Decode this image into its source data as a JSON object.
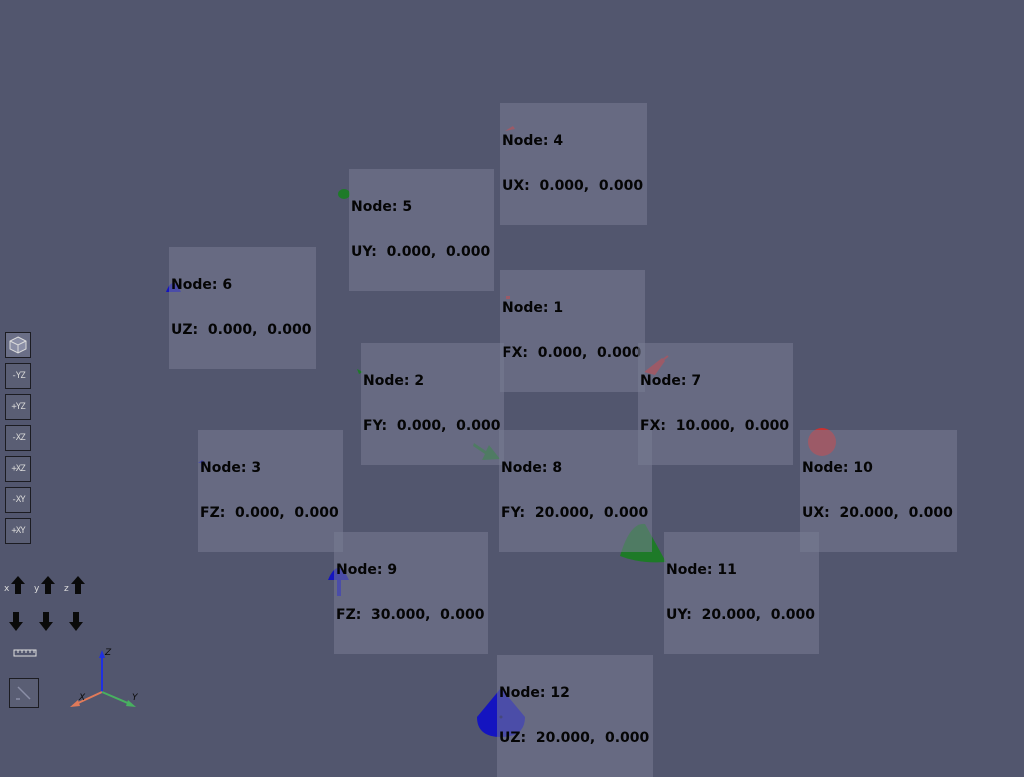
{
  "nodes": [
    {
      "title": "Node: 4",
      "value": "UX:  0.000,  0.000"
    },
    {
      "title": "Node: 5",
      "value": "UY:  0.000,  0.000"
    },
    {
      "title": "Node: 6",
      "value": "UZ:  0.000,  0.000"
    },
    {
      "title": "Node: 1",
      "value": "FX:  0.000,  0.000"
    },
    {
      "title": "Node: 2",
      "value": "FY:  0.000,  0.000"
    },
    {
      "title": "Node: 7",
      "value": "FX:  10.000,  0.000"
    },
    {
      "title": "Node: 3",
      "value": "FZ:  0.000,  0.000"
    },
    {
      "title": "Node: 8",
      "value": "FY:  20.000,  0.000"
    },
    {
      "title": "Node: 10",
      "value": "UX:  20.000,  0.000"
    },
    {
      "title": "Node: 9",
      "value": "FZ:  30.000,  0.000"
    },
    {
      "title": "Node: 11",
      "value": "UY:  20.000,  0.000"
    },
    {
      "title": "Node: 12",
      "value": "UZ:  20.000,  0.000"
    }
  ],
  "toolbar": {
    "views": [
      {
        "icon": "cube-icon",
        "label": ""
      },
      {
        "icon": "view-neg-yz-icon",
        "label": "-YZ"
      },
      {
        "icon": "view-pos-yz-icon",
        "label": "+YZ"
      },
      {
        "icon": "view-neg-xz-icon",
        "label": "-XZ"
      },
      {
        "icon": "view-pos-xz-icon",
        "label": "+XZ"
      },
      {
        "icon": "view-neg-xy-icon",
        "label": "-XY"
      },
      {
        "icon": "view-pos-xy-icon",
        "label": "+XY"
      }
    ],
    "axis_up": [
      "x",
      "y",
      "z"
    ]
  },
  "triad": {
    "x_label": "X",
    "y_label": "Y",
    "z_label": "Z"
  },
  "colors": {
    "background": "#52566e",
    "x_red": "#c83232",
    "y_green": "#1e7a28",
    "z_blue": "#1414c0"
  }
}
